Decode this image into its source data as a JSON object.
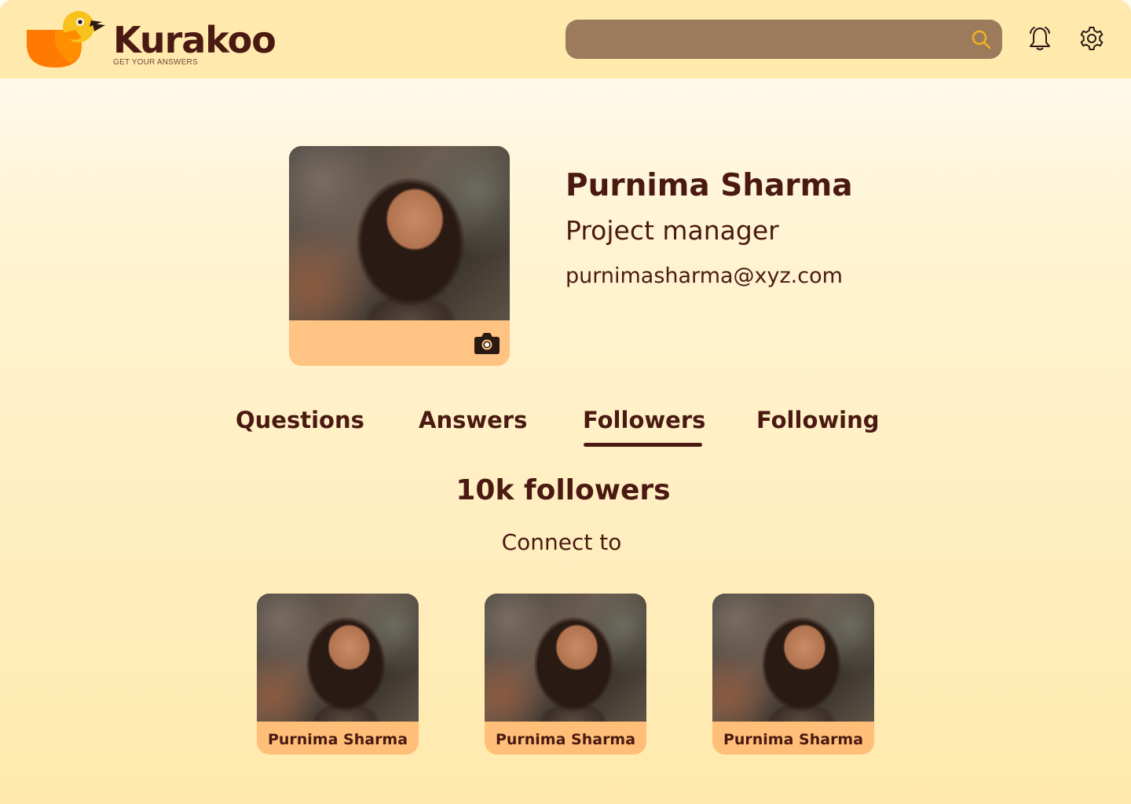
{
  "app": {
    "brand": "Kurakoo",
    "tagline": "GET YOUR ANSWERS"
  },
  "header": {
    "search_placeholder": "",
    "icons": [
      "search-icon",
      "bell-icon",
      "gear-icon"
    ]
  },
  "profile": {
    "name": "Purnima Sharma",
    "role": "Project manager",
    "email": "purnimasharma@xyz.com",
    "camera_icon": "camera-icon"
  },
  "tabs": [
    {
      "label": "Questions",
      "active": false
    },
    {
      "label": "Answers",
      "active": false
    },
    {
      "label": "Followers",
      "active": true
    },
    {
      "label": "Following",
      "active": false
    }
  ],
  "followers": {
    "count_label": "10k followers",
    "connect_label": "Connect to",
    "suggestions": [
      {
        "name": "Purnima Sharma"
      },
      {
        "name": "Purnima Sharma"
      },
      {
        "name": "Purnima Sharma"
      }
    ]
  },
  "colors": {
    "accent_dark": "#4a1a12",
    "header_bg": "#ffe9ad",
    "search_bg": "#9c7b5d",
    "card_bg": "#ffbf78",
    "logo_orange": "#ff7a00",
    "logo_yellow": "#f7c21c"
  }
}
